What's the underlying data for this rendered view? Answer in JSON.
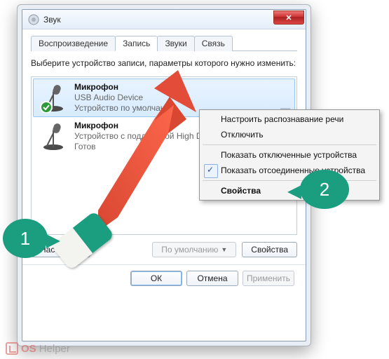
{
  "window": {
    "title": "Звук",
    "close_glyph": "✕"
  },
  "tabs": [
    {
      "label": "Воспроизведение"
    },
    {
      "label": "Запись"
    },
    {
      "label": "Звуки"
    },
    {
      "label": "Связь"
    }
  ],
  "active_tab_index": 1,
  "instruction": "Выберите устройство записи, параметры которого нужно изменить:",
  "devices": [
    {
      "name": "Микрофон",
      "driver": "USB Audio Device",
      "status": "Устройство по умолчанию",
      "selected": true,
      "has_check": true
    },
    {
      "name": "Микрофон",
      "driver": "Устройство с поддержкой High Definition Audio",
      "status": "Готов",
      "selected": false,
      "has_check": false
    }
  ],
  "buttons": {
    "configure": "Настроить",
    "default_dd": "По умолчанию",
    "properties": "Свойства",
    "ok": "ОК",
    "cancel": "Отмена",
    "apply": "Применить"
  },
  "context_menu": {
    "items": [
      {
        "label": "Настроить распознавание речи"
      },
      {
        "label": "Отключить"
      },
      {
        "sep": true
      },
      {
        "label": "Показать отключенные устройства"
      },
      {
        "label": "Показать отсоединенные устройства",
        "checked": true
      },
      {
        "sep": true
      },
      {
        "label": "Свойства",
        "bold": true
      }
    ]
  },
  "annotations": {
    "label1": "1",
    "label2": "2"
  },
  "watermark": {
    "part1": "OS",
    "part2": "Helper"
  },
  "icons": {
    "speaker": "speaker-icon",
    "mic": "mic-icon",
    "checkmark": "green-check-icon",
    "dropdown": "chevron-down-icon",
    "close": "close-icon",
    "grip": "grip-icon"
  }
}
